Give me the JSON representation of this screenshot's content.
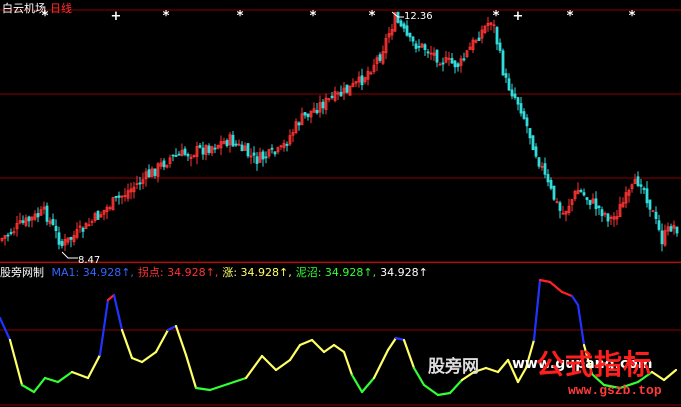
{
  "header": {
    "stock_name": "白云机场",
    "period": "日线"
  },
  "price_panel": {
    "high_label": "12.36",
    "low_label": "8.47"
  },
  "indicator_bar": {
    "name": "股旁网制",
    "items": [
      {
        "label": "MA1:",
        "value": "34.928",
        "color": "#3366ff"
      },
      {
        "label": "拐点:",
        "value": "34.928",
        "color": "#ff3333"
      },
      {
        "label": "涨:",
        "value": "34.928",
        "color": "#ffff66"
      },
      {
        "label": "泥沼:",
        "value": "34.928",
        "color": "#33ff33"
      },
      {
        "label": "",
        "value": "34.928",
        "color": "#ffffff"
      }
    ],
    "arrow": "↑"
  },
  "watermark": {
    "site": "股旁网",
    "url1": "www.gupang.com",
    "brand": "公式指标",
    "url2": "www.gszb.top"
  },
  "colors": {
    "up": "#ff3333",
    "down": "#33dddd",
    "grid": "#8b0000",
    "blue": "#2233ff",
    "yellow": "#ffff66",
    "green": "#33ff33",
    "red": "#ff2222"
  }
}
